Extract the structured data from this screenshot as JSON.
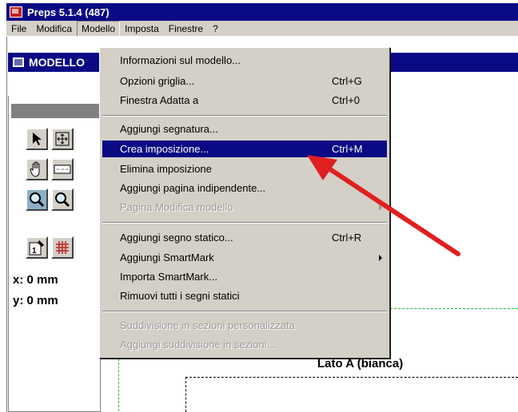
{
  "window": {
    "title": "Preps 5.1.4 (487)"
  },
  "menubar": [
    "File",
    "Modifica",
    "Modello",
    "Imposta",
    "Finestre",
    "?"
  ],
  "document": {
    "title": "MODELLO"
  },
  "coords": {
    "x": "x: 0 mm",
    "y": "y: 0 mm"
  },
  "canvas": {
    "side_label": "Lato A (bianca)"
  },
  "menu": {
    "items": [
      {
        "label": "Informazioni sul modello...",
        "shortcut": ""
      },
      {
        "label": "Opzioni griglia...",
        "shortcut": "Ctrl+G"
      },
      {
        "label": "Finestra Adatta a",
        "shortcut": "Ctrl+0"
      },
      {
        "label": "Aggiungi segnatura...",
        "shortcut": ""
      },
      {
        "label": "Crea imposizione...",
        "shortcut": "Ctrl+M"
      },
      {
        "label": "Elimina imposizione",
        "shortcut": ""
      },
      {
        "label": "Aggiungi pagina indipendente...",
        "shortcut": ""
      },
      {
        "label": "Pagina Modifica modello",
        "shortcut": ""
      },
      {
        "label": "Aggiungi segno statico...",
        "shortcut": "Ctrl+R"
      },
      {
        "label": "Aggiungi SmartMark",
        "shortcut": ""
      },
      {
        "label": "Importa SmartMark...",
        "shortcut": ""
      },
      {
        "label": "Rimuovi tutti i segni statici",
        "shortcut": ""
      },
      {
        "label": "Suddivisione in sezioni personalizzata",
        "shortcut": ""
      },
      {
        "label": "Aggiungi suddivisione in sezioni...",
        "shortcut": ""
      }
    ]
  },
  "colors": {
    "titlebar": "#0a0a84",
    "selection": "#0a0a84",
    "arrow": "#e02020",
    "guides": "#22c02c"
  }
}
